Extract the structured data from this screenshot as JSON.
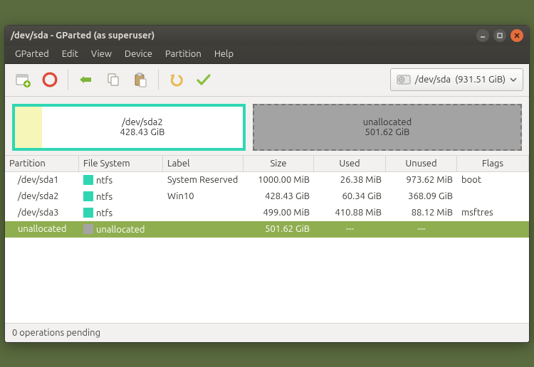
{
  "window": {
    "title": "/dev/sda - GParted (as superuser)"
  },
  "menu": {
    "items": [
      "GParted",
      "Edit",
      "View",
      "Device",
      "Partition",
      "Help"
    ]
  },
  "device_selector": {
    "device": "/dev/sda",
    "size_label": "(931.51 GiB)"
  },
  "visual_map": {
    "selected": {
      "name": "/dev/sda2",
      "size": "428.43 GiB",
      "flex": 460
    },
    "unallocated": {
      "name": "unallocated",
      "size": "501.62 GiB",
      "flex": 538
    }
  },
  "columns": {
    "partition": "Partition",
    "fs": "File System",
    "label": "Label",
    "size": "Size",
    "used": "Used",
    "unused": "Unused",
    "flags": "Flags"
  },
  "rows": [
    {
      "partition": "/dev/sda1",
      "fs": "ntfs",
      "fs_color": "ntfs",
      "label": "System Reserved",
      "size": "1000.00 MiB",
      "used": "26.38 MiB",
      "unused": "973.62 MiB",
      "flags": "boot",
      "selected": false
    },
    {
      "partition": "/dev/sda2",
      "fs": "ntfs",
      "fs_color": "ntfs",
      "label": "Win10",
      "size": "428.43 GiB",
      "used": "60.34 GiB",
      "unused": "368.09 GiB",
      "flags": "",
      "selected": false
    },
    {
      "partition": "/dev/sda3",
      "fs": "ntfs",
      "fs_color": "ntfs",
      "label": "",
      "size": "499.00 MiB",
      "used": "410.88 MiB",
      "unused": "88.12 MiB",
      "flags": "msftres",
      "selected": false
    },
    {
      "partition": "unallocated",
      "fs": "unallocated",
      "fs_color": "una",
      "label": "",
      "size": "501.62 GiB",
      "used": "---",
      "unused": "---",
      "flags": "",
      "selected": true
    }
  ],
  "status": {
    "text": "0 operations pending"
  }
}
